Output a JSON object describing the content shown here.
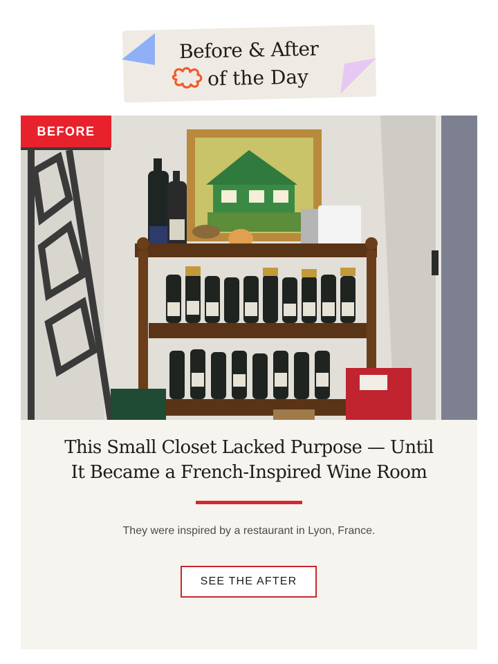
{
  "banner": {
    "title_line1": "Before & After",
    "title_line2": "of the Day",
    "squiggle_icon": "squiggle-icon",
    "accent_colors": {
      "blue": "#8fb0f4",
      "lilac": "#e7c8f5",
      "squiggle": "#f05a2a"
    }
  },
  "article": {
    "image_tag": "BEFORE",
    "headline_line1": "This Small Closet Lacked Purpose — Until",
    "headline_line2": "It Became a French-Inspired Wine Room",
    "subhead": "They were inspired by a restaurant in Lyon, France.",
    "cta_label": "SEE THE AFTER",
    "accent_color": "#e8222d"
  }
}
